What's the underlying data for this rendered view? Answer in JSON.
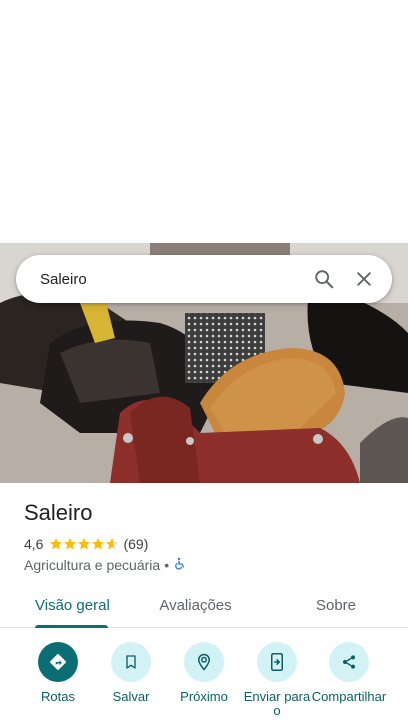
{
  "search": {
    "query": "Saleiro"
  },
  "place": {
    "name": "Saleiro",
    "rating": "4,6",
    "rating_value": 4.6,
    "reviews_count": "(69)",
    "category": "Agricultura e pecuária",
    "separator": "•",
    "accessibility_icon": "wheelchair-icon"
  },
  "tabs": [
    {
      "label": "Visão geral",
      "active": true
    },
    {
      "label": "Avaliações",
      "active": false
    },
    {
      "label": "Sobre",
      "active": false
    }
  ],
  "actions": [
    {
      "label": "Rotas",
      "icon": "directions-icon"
    },
    {
      "label": "Salvar",
      "icon": "bookmark-icon"
    },
    {
      "label": "Próximo",
      "icon": "nearby-icon"
    },
    {
      "label": "Enviar para o",
      "icon": "send-to-phone-icon"
    },
    {
      "label": "Compartilhar",
      "icon": "share-icon"
    }
  ],
  "colors": {
    "accent": "#0b6e75",
    "chip_bg": "#d3f2f6",
    "star": "#fbbc04",
    "accessibility": "#1a73e8"
  }
}
